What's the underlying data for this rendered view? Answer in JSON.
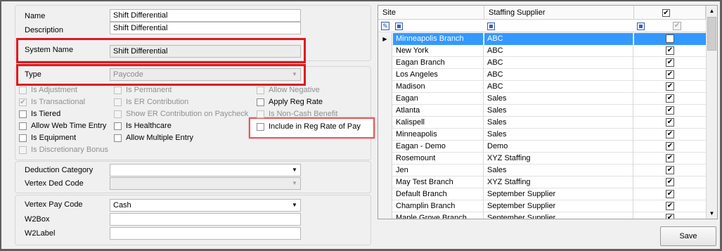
{
  "form": {
    "name_label": "Name",
    "name_value": "Shift Differential",
    "description_label": "Description",
    "description_value": "Shift Differential",
    "system_name_label": "System Name",
    "system_name_value": "Shift Differential",
    "type_label": "Type",
    "type_value": "Paycode",
    "checkboxes": [
      {
        "label": "Is Adjustment",
        "checked": false,
        "enabled": false
      },
      {
        "label": "Is Permanent",
        "checked": false,
        "enabled": false
      },
      {
        "label": "Allow Negative",
        "checked": false,
        "enabled": false
      },
      {
        "label": "Is Transactional",
        "checked": true,
        "enabled": false
      },
      {
        "label": "Is ER Contribution",
        "checked": false,
        "enabled": false
      },
      {
        "label": "Apply Reg Rate",
        "checked": false,
        "enabled": true
      },
      {
        "label": "Is Tiered",
        "checked": false,
        "enabled": true
      },
      {
        "label": "Show ER Contribution on Paycheck",
        "checked": false,
        "enabled": false
      },
      {
        "label": "Is Non-Cash Benefit",
        "checked": false,
        "enabled": false
      },
      {
        "label": "Allow Web Time Entry",
        "checked": false,
        "enabled": true
      },
      {
        "label": "Is Healthcare",
        "checked": false,
        "enabled": true
      },
      {
        "label": "Include in Reg Rate of Pay",
        "checked": false,
        "enabled": true
      },
      {
        "label": "Is Equipment",
        "checked": false,
        "enabled": true
      },
      {
        "label": "Allow Multiple Entry",
        "checked": false,
        "enabled": true
      },
      {
        "label": "Is Discretionary Bonus",
        "checked": false,
        "enabled": false
      }
    ],
    "deduction_category_label": "Deduction Category",
    "deduction_category_value": "",
    "vertex_ded_code_label": "Vertex Ded Code",
    "vertex_ded_code_value": "",
    "vertex_pay_code_label": "Vertex Pay Code",
    "vertex_pay_code_value": "Cash",
    "w2box_label": "W2Box",
    "w2box_value": "",
    "w2label_label": "W2Label",
    "w2label_value": ""
  },
  "grid": {
    "col_site": "Site",
    "col_supplier": "Staffing Supplier",
    "header_all_checked": true,
    "rows": [
      {
        "site": "Minneapolis Branch",
        "supplier": "ABC",
        "checked": true,
        "selected": true
      },
      {
        "site": "New York",
        "supplier": "ABC",
        "checked": true
      },
      {
        "site": "Eagan Branch",
        "supplier": "ABC",
        "checked": true
      },
      {
        "site": "Los Angeles",
        "supplier": "ABC",
        "checked": true
      },
      {
        "site": "Madison",
        "supplier": "ABC",
        "checked": true
      },
      {
        "site": "Eagan",
        "supplier": "Sales",
        "checked": true
      },
      {
        "site": "Atlanta",
        "supplier": "Sales",
        "checked": true
      },
      {
        "site": "Kalispell",
        "supplier": "Sales",
        "checked": true
      },
      {
        "site": "Minneapolis",
        "supplier": "Sales",
        "checked": true
      },
      {
        "site": "Eagan - Demo",
        "supplier": "Demo",
        "checked": true
      },
      {
        "site": "Rosemount",
        "supplier": "XYZ Staffing",
        "checked": true
      },
      {
        "site": "Jen",
        "supplier": "Sales",
        "checked": true
      },
      {
        "site": "May Test Branch",
        "supplier": "XYZ Staffing",
        "checked": true
      },
      {
        "site": "Default Branch",
        "supplier": "September Supplier",
        "checked": true
      },
      {
        "site": "Champlin Branch",
        "supplier": "September Supplier",
        "checked": true
      },
      {
        "site": "Maple Grove Branch",
        "supplier": "September Supplier",
        "checked": true
      }
    ]
  },
  "actions": {
    "save_label": "Save"
  }
}
